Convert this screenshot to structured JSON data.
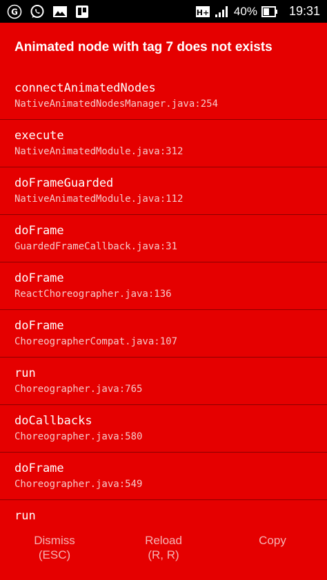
{
  "status_bar": {
    "network_type": "H+",
    "battery": "40%",
    "time": "19:31",
    "icons": [
      "g-icon",
      "whatsapp-icon",
      "image-icon",
      "trello-icon",
      "signal-icon",
      "battery-icon"
    ]
  },
  "error": {
    "title": "Animated node with tag 7 does not exists"
  },
  "stack": [
    {
      "method": "connectAnimatedNodes",
      "file": "NativeAnimatedNodesManager.java:254"
    },
    {
      "method": "execute",
      "file": "NativeAnimatedModule.java:312"
    },
    {
      "method": "doFrameGuarded",
      "file": "NativeAnimatedModule.java:112"
    },
    {
      "method": "doFrame",
      "file": "GuardedFrameCallback.java:31"
    },
    {
      "method": "doFrame",
      "file": "ReactChoreographer.java:136"
    },
    {
      "method": "doFrame",
      "file": "ChoreographerCompat.java:107"
    },
    {
      "method": "run",
      "file": "Choreographer.java:765"
    },
    {
      "method": "doCallbacks",
      "file": "Choreographer.java:580"
    },
    {
      "method": "doFrame",
      "file": "Choreographer.java:549"
    },
    {
      "method": "run",
      "file": ""
    }
  ],
  "buttons": {
    "dismiss": {
      "line1": "Dismiss",
      "line2": "(ESC)"
    },
    "reload": {
      "line1": "Reload",
      "line2": "(R, R)"
    },
    "copy": {
      "line1": "Copy",
      "line2": ""
    }
  },
  "colors": {
    "background": "#e50000",
    "title": "#ffffff",
    "file_text": "#f5c9c9",
    "button_text": "#f5b3b3"
  }
}
